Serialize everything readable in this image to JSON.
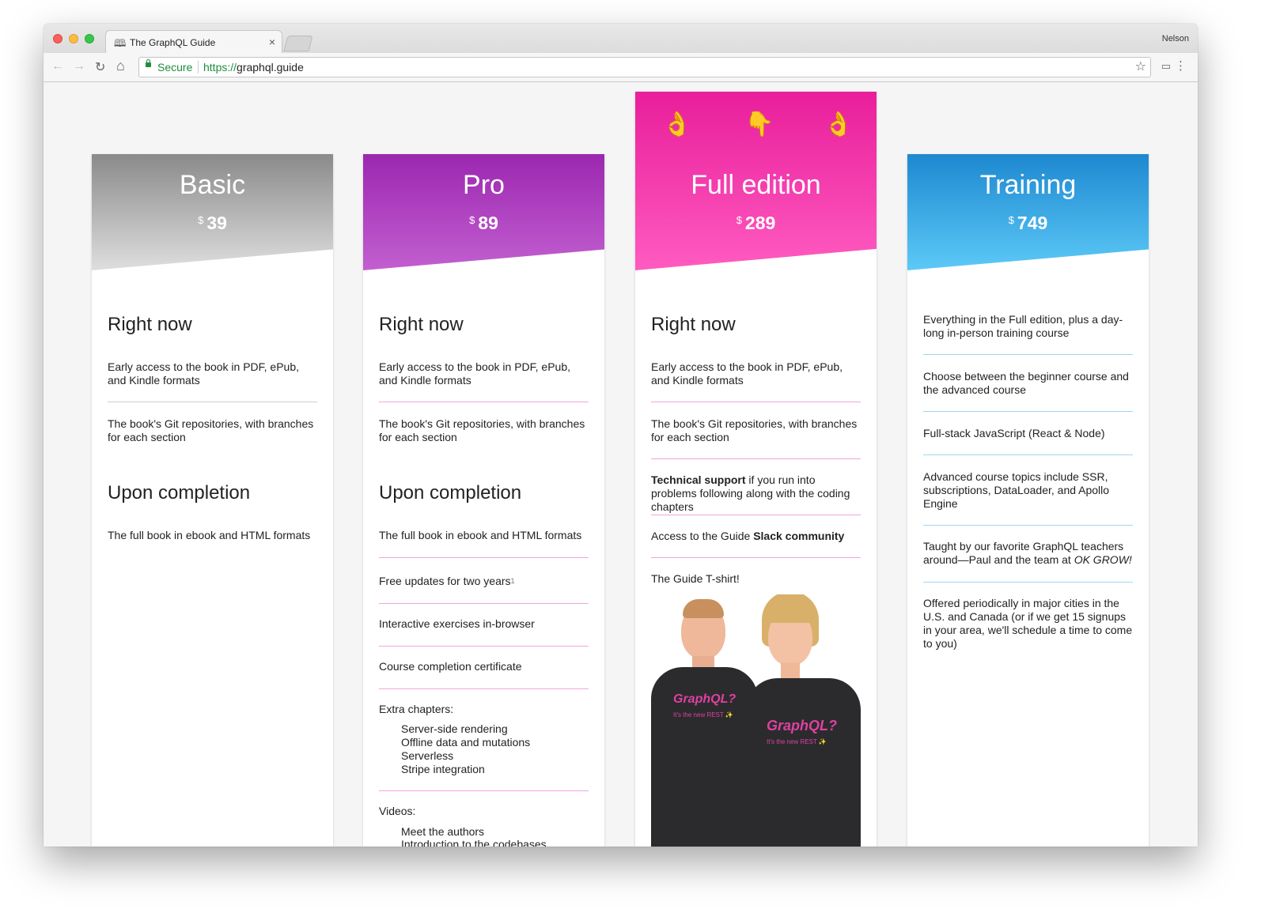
{
  "browser": {
    "tab_title": "The GraphQL Guide",
    "tab_close": "×",
    "profile": "Nelson",
    "secure_label": "Secure",
    "url_proto": "https://",
    "url_host": "graphql.guide",
    "icons": {
      "back": "←",
      "forward": "→",
      "reload": "↻",
      "home": "⌂",
      "star": "☆",
      "menu": "⋮",
      "cast": "▭",
      "tab": "🕮"
    }
  },
  "plans": {
    "basic": {
      "name": "Basic",
      "currency": "$",
      "price": "39",
      "sections": {
        "now_title": "Right now",
        "now_items": [
          "Early access to the book in PDF, ePub, and Kindle formats",
          "The book's Git repositories, with branches for each section"
        ],
        "later_title": "Upon completion",
        "later_items": [
          "The full book in ebook and HTML formats"
        ]
      }
    },
    "pro": {
      "name": "Pro",
      "currency": "$",
      "price": "89",
      "now_title": "Right now",
      "now_items": [
        "Early access to the book in PDF, ePub, and Kindle formats",
        "The book's Git repositories, with branches for each section"
      ],
      "later_title": "Upon completion",
      "later_items": [
        "The full book in ebook and HTML formats",
        "Free updates for two years",
        "Interactive exercises in-browser",
        "Course completion certificate"
      ],
      "footnote": "1",
      "extra_title": "Extra chapters:",
      "extra_items": [
        "Server-side rendering",
        "Offline data and mutations",
        "Serverless",
        "Stripe integration"
      ],
      "videos_title": "Videos:",
      "video_items": [
        "Meet the authors",
        "Introduction to the codebases"
      ]
    },
    "full": {
      "name": "Full edition",
      "currency": "$",
      "price": "289",
      "emojis": [
        "👌",
        "👇",
        "👌"
      ],
      "now_title": "Right now",
      "items": [
        "Early access to the book in PDF, ePub, and Kindle formats",
        "The book's Git repositories, with branches for each section"
      ],
      "support_bold": "Technical support",
      "support_rest": " if you run into problems following along with the coding chapters",
      "slack_pre": "Access to the Guide ",
      "slack_bold": "Slack community",
      "tshirt": "The Guide T-shirt!",
      "shirt_text": "GraphQL?",
      "shirt_sub": "It's the new REST ✨"
    },
    "training": {
      "name": "Training",
      "currency": "$",
      "price": "749",
      "items": [
        "Everything in the Full edition, plus a day-long in-person training course",
        "Choose between the beginner course and the advanced course",
        "Full-stack JavaScript (React & Node)",
        "Advanced course topics include SSR, subscriptions, DataLoader, and Apollo Engine"
      ],
      "teachers_pre": "Taught by our favorite GraphQL teachers around—Paul and the team at ",
      "teachers_em": "OK GROW!",
      "offered": "Offered periodically in major cities in the U.S. and Canada (or if we get 15 signups in your area, we'll schedule a time to come to you)"
    }
  }
}
